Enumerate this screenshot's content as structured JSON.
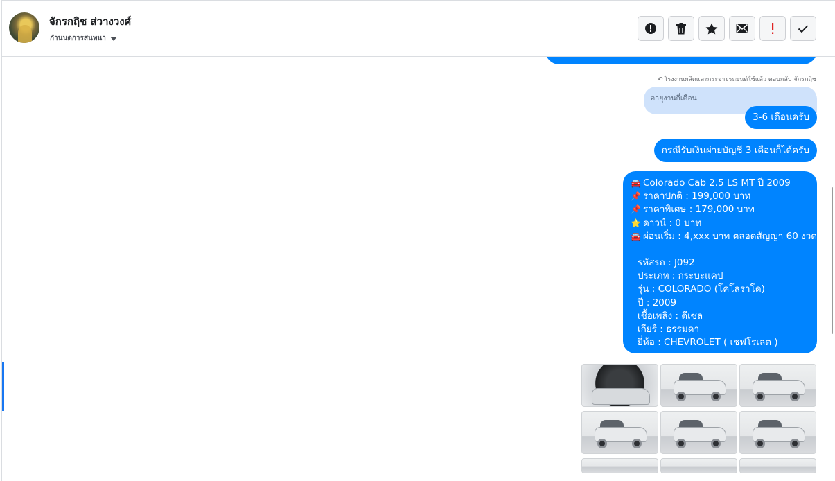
{
  "header": {
    "name": "จักรกฤิช ส่วางวงศ์",
    "subtitle": "กำนนดการสนทนา"
  },
  "toolbar": {
    "buttons": [
      {
        "icon": "alert-circle-icon",
        "label": "Mark as spam"
      },
      {
        "icon": "trash-icon",
        "label": "Delete"
      },
      {
        "icon": "star-icon",
        "label": "Star"
      },
      {
        "icon": "envelope-icon",
        "label": "Mark as unread"
      },
      {
        "icon": "exclamation-icon",
        "label": "Mark important"
      },
      {
        "icon": "checkmark-icon",
        "label": "Mark done"
      }
    ]
  },
  "conversation": {
    "reply_note": "โรงงานผลิตและกระจายรถยนต์ใช้แล้ว ตอบกลับ จักรกฤิช",
    "quoted_text": "อายุงานกี่เดือน",
    "messages": [
      "3-6 เดือนครับ",
      "กรณีรับเงินผ่ายบัญชี 3 เดือนก็ได้ครับ"
    ],
    "listing": {
      "lines": [
        {
          "emoji": "🚘",
          "text": "Colorado Cab 2.5 LS MT ปี 2009"
        },
        {
          "emoji": "📌",
          "text": "ราคาปกติ : 199,000 บาท"
        },
        {
          "emoji": "📌",
          "text": "ราคาพิเศษ : 179,000 บาท"
        },
        {
          "emoji": "⭐",
          "text": "ดาวน์ : 0 บาท"
        },
        {
          "emoji": "🚘",
          "text": "ผ่อนเริ่ม : 4,xxx บาท ตลอดสัญญา 60 งวด"
        }
      ],
      "specs": [
        "รหัสรถ : J092",
        "ประเภท : กระบะแคป",
        "รุ่น : COLORADO (โคโลราโด)",
        "ปี : 2009",
        "เชื้อเพลิง : ดีเซล",
        "เกียร์ : ธรรมดา",
        "ยี่ห้อ : CHEVROLET ( เชฟโรเลต )"
      ]
    },
    "photos": [
      {
        "view": "engine-bay"
      },
      {
        "view": "front-left"
      },
      {
        "view": "front"
      },
      {
        "view": "side-left"
      },
      {
        "view": "rear-right"
      },
      {
        "view": "rear"
      },
      {
        "view": "partial"
      },
      {
        "view": "partial"
      },
      {
        "view": "partial"
      }
    ]
  },
  "colors": {
    "bubble": "#0084ff",
    "quote": "#cfe2fb",
    "accent": "#1877f2"
  }
}
